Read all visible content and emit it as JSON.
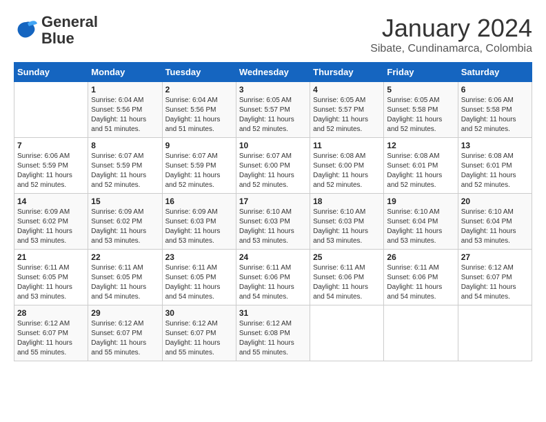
{
  "header": {
    "logo_general": "General",
    "logo_blue": "Blue",
    "month_year": "January 2024",
    "location": "Sibate, Cundinamarca, Colombia"
  },
  "calendar": {
    "days_of_week": [
      "Sunday",
      "Monday",
      "Tuesday",
      "Wednesday",
      "Thursday",
      "Friday",
      "Saturday"
    ],
    "weeks": [
      [
        {
          "day": "",
          "info": ""
        },
        {
          "day": "1",
          "info": "Sunrise: 6:04 AM\nSunset: 5:56 PM\nDaylight: 11 hours and 51 minutes."
        },
        {
          "day": "2",
          "info": "Sunrise: 6:04 AM\nSunset: 5:56 PM\nDaylight: 11 hours and 51 minutes."
        },
        {
          "day": "3",
          "info": "Sunrise: 6:05 AM\nSunset: 5:57 PM\nDaylight: 11 hours and 52 minutes."
        },
        {
          "day": "4",
          "info": "Sunrise: 6:05 AM\nSunset: 5:57 PM\nDaylight: 11 hours and 52 minutes."
        },
        {
          "day": "5",
          "info": "Sunrise: 6:05 AM\nSunset: 5:58 PM\nDaylight: 11 hours and 52 minutes."
        },
        {
          "day": "6",
          "info": "Sunrise: 6:06 AM\nSunset: 5:58 PM\nDaylight: 11 hours and 52 minutes."
        }
      ],
      [
        {
          "day": "7",
          "info": "Sunrise: 6:06 AM\nSunset: 5:59 PM\nDaylight: 11 hours and 52 minutes."
        },
        {
          "day": "8",
          "info": "Sunrise: 6:07 AM\nSunset: 5:59 PM\nDaylight: 11 hours and 52 minutes."
        },
        {
          "day": "9",
          "info": "Sunrise: 6:07 AM\nSunset: 5:59 PM\nDaylight: 11 hours and 52 minutes."
        },
        {
          "day": "10",
          "info": "Sunrise: 6:07 AM\nSunset: 6:00 PM\nDaylight: 11 hours and 52 minutes."
        },
        {
          "day": "11",
          "info": "Sunrise: 6:08 AM\nSunset: 6:00 PM\nDaylight: 11 hours and 52 minutes."
        },
        {
          "day": "12",
          "info": "Sunrise: 6:08 AM\nSunset: 6:01 PM\nDaylight: 11 hours and 52 minutes."
        },
        {
          "day": "13",
          "info": "Sunrise: 6:08 AM\nSunset: 6:01 PM\nDaylight: 11 hours and 52 minutes."
        }
      ],
      [
        {
          "day": "14",
          "info": "Sunrise: 6:09 AM\nSunset: 6:02 PM\nDaylight: 11 hours and 53 minutes."
        },
        {
          "day": "15",
          "info": "Sunrise: 6:09 AM\nSunset: 6:02 PM\nDaylight: 11 hours and 53 minutes."
        },
        {
          "day": "16",
          "info": "Sunrise: 6:09 AM\nSunset: 6:03 PM\nDaylight: 11 hours and 53 minutes."
        },
        {
          "day": "17",
          "info": "Sunrise: 6:10 AM\nSunset: 6:03 PM\nDaylight: 11 hours and 53 minutes."
        },
        {
          "day": "18",
          "info": "Sunrise: 6:10 AM\nSunset: 6:03 PM\nDaylight: 11 hours and 53 minutes."
        },
        {
          "day": "19",
          "info": "Sunrise: 6:10 AM\nSunset: 6:04 PM\nDaylight: 11 hours and 53 minutes."
        },
        {
          "day": "20",
          "info": "Sunrise: 6:10 AM\nSunset: 6:04 PM\nDaylight: 11 hours and 53 minutes."
        }
      ],
      [
        {
          "day": "21",
          "info": "Sunrise: 6:11 AM\nSunset: 6:05 PM\nDaylight: 11 hours and 53 minutes."
        },
        {
          "day": "22",
          "info": "Sunrise: 6:11 AM\nSunset: 6:05 PM\nDaylight: 11 hours and 54 minutes."
        },
        {
          "day": "23",
          "info": "Sunrise: 6:11 AM\nSunset: 6:05 PM\nDaylight: 11 hours and 54 minutes."
        },
        {
          "day": "24",
          "info": "Sunrise: 6:11 AM\nSunset: 6:06 PM\nDaylight: 11 hours and 54 minutes."
        },
        {
          "day": "25",
          "info": "Sunrise: 6:11 AM\nSunset: 6:06 PM\nDaylight: 11 hours and 54 minutes."
        },
        {
          "day": "26",
          "info": "Sunrise: 6:11 AM\nSunset: 6:06 PM\nDaylight: 11 hours and 54 minutes."
        },
        {
          "day": "27",
          "info": "Sunrise: 6:12 AM\nSunset: 6:07 PM\nDaylight: 11 hours and 54 minutes."
        }
      ],
      [
        {
          "day": "28",
          "info": "Sunrise: 6:12 AM\nSunset: 6:07 PM\nDaylight: 11 hours and 55 minutes."
        },
        {
          "day": "29",
          "info": "Sunrise: 6:12 AM\nSunset: 6:07 PM\nDaylight: 11 hours and 55 minutes."
        },
        {
          "day": "30",
          "info": "Sunrise: 6:12 AM\nSunset: 6:07 PM\nDaylight: 11 hours and 55 minutes."
        },
        {
          "day": "31",
          "info": "Sunrise: 6:12 AM\nSunset: 6:08 PM\nDaylight: 11 hours and 55 minutes."
        },
        {
          "day": "",
          "info": ""
        },
        {
          "day": "",
          "info": ""
        },
        {
          "day": "",
          "info": ""
        }
      ]
    ]
  }
}
